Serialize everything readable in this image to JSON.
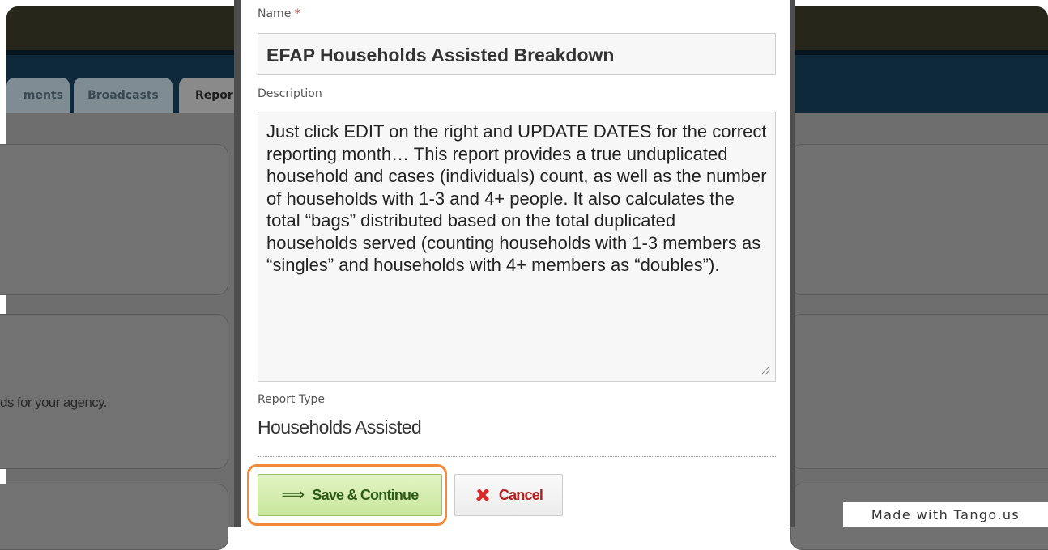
{
  "background": {
    "tabs": [
      "ments",
      "Broadcasts",
      "Repor"
    ],
    "agency_text": "ds for your agency."
  },
  "modal": {
    "name_label": "Name",
    "name_required": "*",
    "name_value": "EFAP Households Assisted Breakdown",
    "description_label": "Description",
    "description_value": "Just click EDIT on the right and UPDATE DATES for the correct reporting month… This report provides a true unduplicated household and cases (individuals) count, as well as the number of households with 1-3 and 4+ people. It also calculates the total “bags” distributed based on the total duplicated households served (counting households with 1-3 members as “singles” and households with 4+ members as “doubles”).",
    "report_type_label": "Report Type",
    "report_type_value": "Households Assisted",
    "save_button": "Save & Continue",
    "cancel_button": "Cancel"
  },
  "icons": {
    "save": "arrow-right-icon",
    "cancel": "red-x-icon",
    "resize": "resize-grip-icon"
  },
  "colors": {
    "highlight": "#f08a3a",
    "save_bg": "#d4ecb0",
    "cancel_text": "#b42020"
  },
  "watermark": "Made with Tango.us"
}
